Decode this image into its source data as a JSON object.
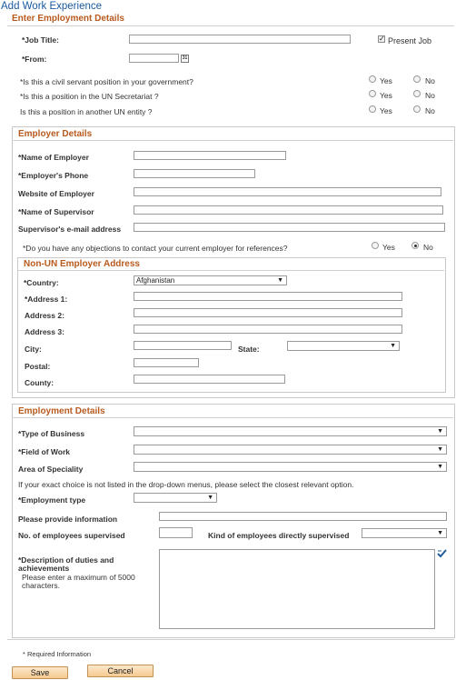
{
  "page_title": "Add Work Experience",
  "employment": {
    "heading": "Enter Employment Details",
    "job_title_label": "*Job Title:",
    "present_job_label": "Present Job",
    "from_label": "*From:",
    "q_civil": "*Is this a civil servant position in your government?",
    "q_secretariat": "*Is this a position in the UN Secretariat ?",
    "q_other_entity": "Is this a position in another UN entity ?",
    "yes": "Yes",
    "no": "No"
  },
  "employer": {
    "heading": "Employer Details",
    "name_label": "*Name of Employer",
    "phone_label": "*Employer's Phone",
    "website_label": "Website of Employer",
    "supervisor_label": "*Name of Supervisor",
    "supervisor_email_label": "Supervisor's e-mail address",
    "q_objection": "*Do you have any objections to contact your current employer for references?",
    "yes": "Yes",
    "no": "No"
  },
  "address": {
    "heading": "Non-UN Employer Address",
    "country_label": "*Country:",
    "country_value": "Afghanistan",
    "address1_label": "*Address 1:",
    "address2_label": "Address 2:",
    "address3_label": "Address 3:",
    "city_label": "City:",
    "state_label": "State:",
    "postal_label": "Postal:",
    "county_label": "County:"
  },
  "details": {
    "heading": "Employment Details",
    "business_label": "*Type of Business",
    "field_label": "*Field of Work",
    "speciality_label": "Area of Speciality",
    "note": "If your exact choice is not listed in the drop-down menus, please select the closest relevant option.",
    "emp_type_label": "*Employment type",
    "provide_info_label": "Please provide information",
    "num_supervised_label": "No. of employees supervised",
    "kind_supervised_label": "Kind of employees directly supervised",
    "description_label": "*Description of duties and achievements",
    "description_hint": "Please enter a maximum of 5000 characters."
  },
  "footer": {
    "required_note": "* Required Information",
    "save_label": "Save",
    "cancel_label": "Cancel"
  }
}
